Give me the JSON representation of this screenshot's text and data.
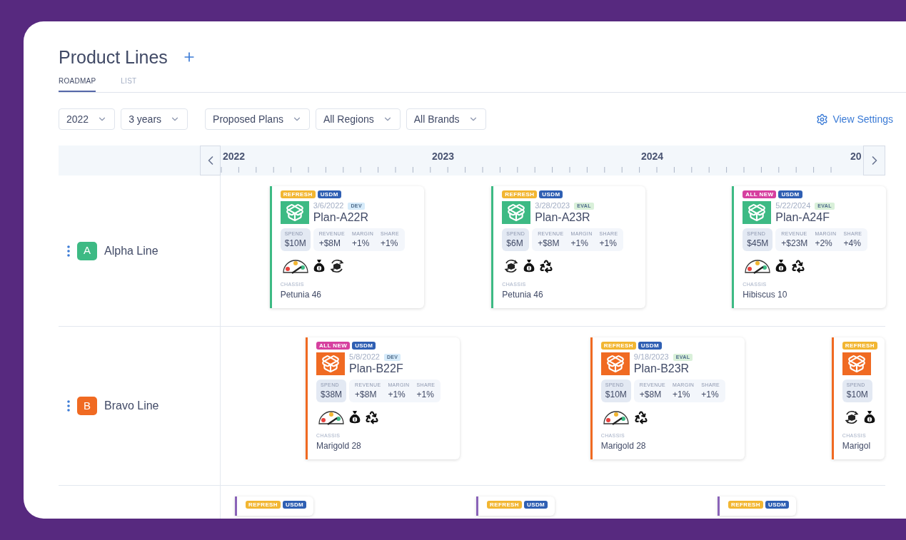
{
  "header": {
    "title": "Product Lines"
  },
  "tabs": [
    {
      "label": "ROADMAP",
      "selected": true
    },
    {
      "label": "LIST",
      "selected": false
    }
  ],
  "filters": [
    {
      "value": "2022"
    },
    {
      "value": "3 years"
    },
    {
      "value": "Proposed Plans"
    },
    {
      "value": "All Regions"
    },
    {
      "value": "All Brands"
    }
  ],
  "view_settings": "View Settings",
  "timeline": {
    "years": [
      "2022",
      "2023",
      "2024",
      "20"
    ]
  },
  "lines": [
    {
      "letter": "A",
      "name": "Alpha Line",
      "color": "#3dba84",
      "plans": [
        {
          "kind": "full",
          "badges": [
            {
              "label": "REFRESH",
              "color": "#f2b632"
            },
            {
              "label": "USDM",
              "color": "#2f5fb3"
            }
          ],
          "date": "3/6/2022",
          "stage": {
            "label": "DEV",
            "color": "#d6ebfa"
          },
          "plan": "Plan-A22R",
          "metrics": [
            {
              "kind": "spend",
              "label": "SPEND",
              "value": "$10M"
            },
            {
              "kind": "other",
              "label": "REVENUE",
              "value": "+$8M"
            },
            {
              "kind": "other",
              "label": "MARGIN",
              "value": "+1%"
            },
            {
              "kind": "other",
              "label": "SHARE",
              "value": "+1%"
            }
          ],
          "indicators": [
            {
              "kind": "gauge"
            },
            {
              "kind": "money"
            },
            {
              "kind": "rotate"
            }
          ],
          "chassis_label": "CHASSIS",
          "chassis": "Petunia 46"
        },
        {
          "kind": "full",
          "badges": [
            {
              "label": "REFRESH",
              "color": "#f2b632"
            },
            {
              "label": "USDM",
              "color": "#2f5fb3"
            }
          ],
          "date": "3/28/2023",
          "stage": {
            "label": "EVAL",
            "color": "#d9f0d9"
          },
          "plan": "Plan-A23R",
          "metrics": [
            {
              "kind": "spend",
              "label": "SPEND",
              "value": "$6M"
            },
            {
              "kind": "other",
              "label": "REVENUE",
              "value": "+$8M"
            },
            {
              "kind": "other",
              "label": "MARGIN",
              "value": "+1%"
            },
            {
              "kind": "other",
              "label": "SHARE",
              "value": "+1%"
            }
          ],
          "indicators": [
            {
              "kind": "rotate"
            },
            {
              "kind": "money"
            },
            {
              "kind": "recycle"
            }
          ],
          "chassis_label": "CHASSIS",
          "chassis": "Petunia 46"
        },
        {
          "kind": "full",
          "badges": [
            {
              "label": "ALL NEW",
              "color": "#d6409f"
            },
            {
              "label": "USDM",
              "color": "#2f5fb3"
            }
          ],
          "date": "5/22/2024",
          "stage": {
            "label": "EVAL",
            "color": "#d9f0d9"
          },
          "plan": "Plan-A24F",
          "metrics": [
            {
              "kind": "spend",
              "label": "SPEND",
              "value": "$45M"
            },
            {
              "kind": "other",
              "label": "REVENUE",
              "value": "+$23M"
            },
            {
              "kind": "other",
              "label": "MARGIN",
              "value": "+2%"
            },
            {
              "kind": "other",
              "label": "SHARE",
              "value": "+4%"
            }
          ],
          "indicators": [
            {
              "kind": "gauge"
            },
            {
              "kind": "money"
            },
            {
              "kind": "recycle"
            }
          ],
          "chassis_label": "CHASSIS",
          "chassis": "Hibiscus 10"
        }
      ]
    },
    {
      "letter": "B",
      "name": "Bravo Line",
      "color": "#f06a22",
      "plans": [
        {
          "kind": "full",
          "badges": [
            {
              "label": "ALL NEW",
              "color": "#d6409f"
            },
            {
              "label": "USDM",
              "color": "#2f5fb3"
            }
          ],
          "date": "5/8/2022",
          "stage": {
            "label": "DEV",
            "color": "#d6ebfa"
          },
          "plan": "Plan-B22F",
          "metrics": [
            {
              "kind": "spend",
              "label": "SPEND",
              "value": "$38M"
            },
            {
              "kind": "other",
              "label": "REVENUE",
              "value": "+$8M"
            },
            {
              "kind": "other",
              "label": "MARGIN",
              "value": "+1%"
            },
            {
              "kind": "other",
              "label": "SHARE",
              "value": "+1%"
            }
          ],
          "indicators": [
            {
              "kind": "gauge"
            },
            {
              "kind": "money"
            },
            {
              "kind": "recycle"
            }
          ],
          "chassis_label": "CHASSIS",
          "chassis": "Marigold 28"
        },
        {
          "kind": "full",
          "badges": [
            {
              "label": "REFRESH",
              "color": "#f2b632"
            },
            {
              "label": "USDM",
              "color": "#2f5fb3"
            }
          ],
          "date": "9/18/2023",
          "stage": {
            "label": "EVAL",
            "color": "#d9f0d9"
          },
          "plan": "Plan-B23R",
          "metrics": [
            {
              "kind": "spend",
              "label": "SPEND",
              "value": "$10M"
            },
            {
              "kind": "other",
              "label": "REVENUE",
              "value": "+$8M"
            },
            {
              "kind": "other",
              "label": "MARGIN",
              "value": "+1%"
            },
            {
              "kind": "other",
              "label": "SHARE",
              "value": "+1%"
            }
          ],
          "indicators": [
            {
              "kind": "gauge"
            },
            {
              "kind": "recycle"
            }
          ],
          "chassis_label": "CHASSIS",
          "chassis": "Marigold 28"
        },
        {
          "kind": "cut",
          "badges": [
            {
              "label": "REFRESH",
              "color": "#f2b632"
            }
          ],
          "metrics": [
            {
              "kind": "spend",
              "label": "SPEND",
              "value": "$10M"
            }
          ],
          "indicators": [
            {
              "kind": "rotate"
            },
            {
              "kind": "money"
            }
          ],
          "chassis_label": "CHASSIS",
          "chassis": "Marigol"
        }
      ]
    },
    {
      "color": "#8a63b8",
      "plans": [
        {
          "kind": "cut",
          "badges": [
            {
              "label": "REFRESH",
              "color": "#f2b632"
            },
            {
              "label": "USDM",
              "color": "#2f5fb3"
            }
          ]
        },
        {
          "kind": "cut",
          "badges": [
            {
              "label": "REFRESH",
              "color": "#f2b632"
            },
            {
              "label": "USDM",
              "color": "#2f5fb3"
            }
          ]
        },
        {
          "kind": "cut",
          "badges": [
            {
              "label": "REFRESH",
              "color": "#f2b632"
            },
            {
              "label": "USDM",
              "color": "#2f5fb3"
            }
          ]
        }
      ]
    }
  ]
}
